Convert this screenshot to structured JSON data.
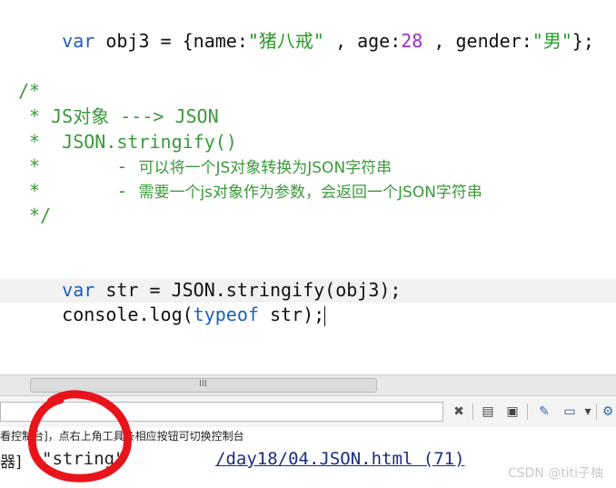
{
  "editor": {
    "line1": {
      "kw": "var",
      "ident": " obj3 = {name:",
      "name_value": "\"猪八戒\"",
      "sep1": " , age:",
      "age_value": "28",
      "sep2": " , gender:",
      "gender_value": "\"男\"",
      "end": "};"
    },
    "comment": {
      "open": "/*",
      "l1": " * JS对象 ---> JSON",
      "l2": " *  JSON.stringify()",
      "l3_prefix": " *       - ",
      "l3_text": "可以将一个JS对象转换为JSON字符串",
      "l4_prefix": " *       - ",
      "l4_text": "需要一个js对象作为参数，会返回一个JSON字符串",
      "close": " */"
    },
    "line_str": {
      "kw": "var",
      "rest": " str = JSON.stringify(obj3);"
    },
    "line_log": {
      "ident": "console.log(",
      "kw": "typeof",
      "rest": " str);"
    }
  },
  "scrollbar": {
    "grip": "III"
  },
  "toolbar": {
    "icons": [
      "close-icon",
      "document-icon",
      "window-icon",
      "pin-icon",
      "monitor-icon",
      "dropdown-icon",
      "settings-icon"
    ],
    "icon_glyphs": {
      "close": "✖",
      "document": "▤",
      "window": "▣",
      "pin": "✎",
      "monitor": "▭",
      "dropdown": "▾",
      "settings": "⚙"
    }
  },
  "console": {
    "info_text": "看控制台]，点右上角工具条相应按钮可切换控制台",
    "output_prefix": "器]",
    "output_value": "\"string\"",
    "source_link": "/day18/04.JSON.html (71)"
  },
  "watermark": "CSDN @titi子柚",
  "colors": {
    "keyword": "#1f5fb8",
    "string": "#2a9a2a",
    "number": "#9b30c8",
    "comment": "#3a9a3a",
    "annotation": "#e8141c"
  }
}
